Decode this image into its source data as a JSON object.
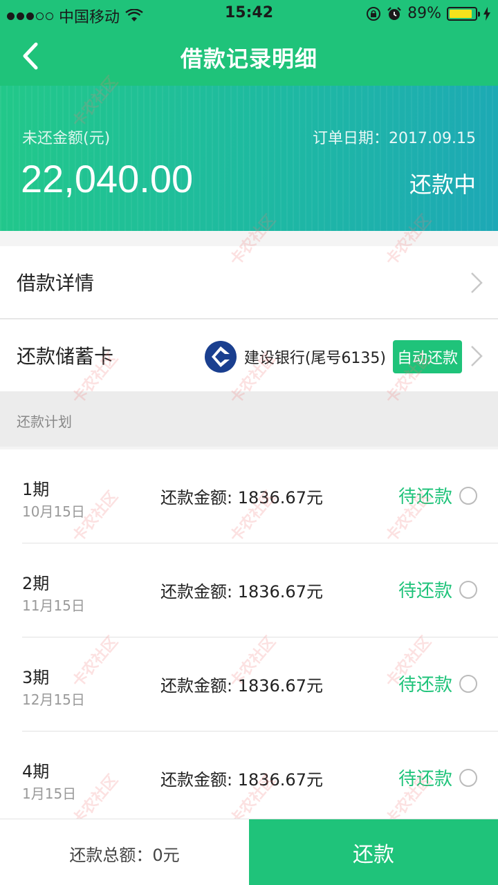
{
  "status_bar": {
    "carrier": "中国移动",
    "time": "15:42",
    "battery": "89%",
    "battery_level": 0.89
  },
  "nav": {
    "title": "借款记录明细"
  },
  "summary": {
    "unpaid_label": "未还金额(元)",
    "order_date": "订单日期：2017.09.15",
    "amount": "22,040.00",
    "status": "还款中"
  },
  "loan_detail": {
    "label": "借款详情"
  },
  "repay_card": {
    "label": "还款储蓄卡",
    "bank": "建设银行(尾号6135)",
    "badge": "自动还款"
  },
  "plan": {
    "header": "还款计划",
    "installments": [
      {
        "period": "1期",
        "date": "10月15日",
        "amount": "还款金额: 1836.67元",
        "status": "待还款"
      },
      {
        "period": "2期",
        "date": "11月15日",
        "amount": "还款金额: 1836.67元",
        "status": "待还款"
      },
      {
        "period": "3期",
        "date": "12月15日",
        "amount": "还款金额: 1836.67元",
        "status": "待还款"
      },
      {
        "period": "4期",
        "date": "1月15日",
        "amount": "还款金额: 1836.67元",
        "status": "待还款"
      }
    ]
  },
  "bottom": {
    "total": "还款总额：0元",
    "repay_button": "还款"
  },
  "watermark": "卡农社区",
  "colors": {
    "accent": "#1fc37a",
    "header_gradient_end": "#1da8b6",
    "bank_blue": "#1a3f8f"
  }
}
